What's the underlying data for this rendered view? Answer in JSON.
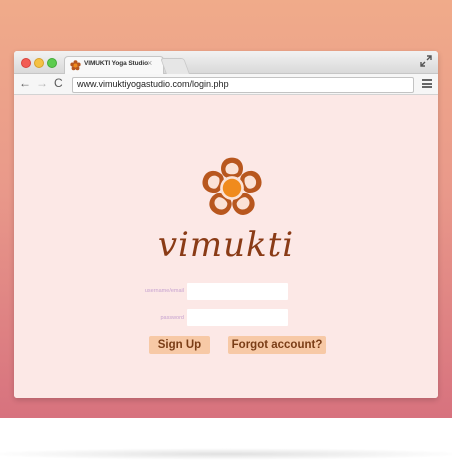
{
  "browser": {
    "tab_title": "VIMUKTI Yoga Studio",
    "tab_close": "×",
    "url": "www.vimuktiyogastudio.com/login.php"
  },
  "toolbar": {
    "back": "←",
    "forward": "→",
    "reload": "C"
  },
  "login": {
    "brand": "vimukti",
    "username_label": "username/email",
    "password_label": "password",
    "username_value": "",
    "password_value": "",
    "signup_label": "Sign Up",
    "forgot_label": "Forgot account?"
  },
  "icons": [
    "vimukti-flower-logo-icon",
    "back-arrow-icon",
    "forward-arrow-icon",
    "reload-icon",
    "menu-icon",
    "fullscreen-icon"
  ],
  "colors": {
    "brand": "#8a3b16",
    "petal": "#b8571e",
    "center": "#f08b1d",
    "button_bg": "#f7c9a6",
    "page_bg": "#fce8e6"
  }
}
